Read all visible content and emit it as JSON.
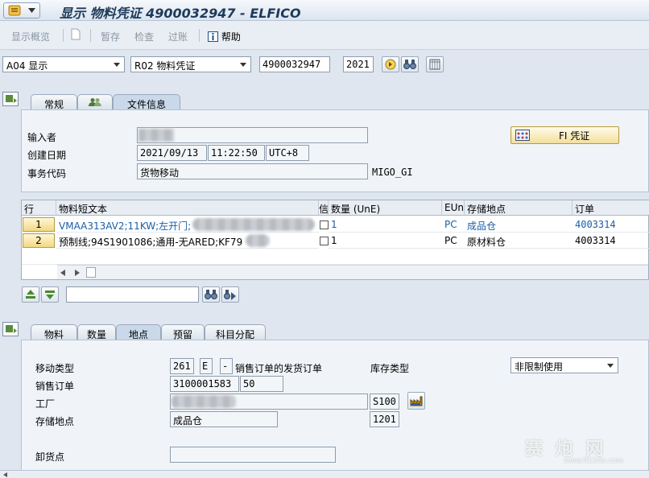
{
  "title": "显示 物料凭证 4900032947 - ELFICO",
  "toolbar": {
    "items": [
      "显示概览",
      "暂存",
      "检查",
      "过账",
      "帮助"
    ]
  },
  "selection": {
    "action": "A04 显示",
    "doc_type": "R02 物料凭证",
    "doc_number": "4900032947",
    "year": "2021"
  },
  "header_tabs": [
    "常规",
    "文件信息"
  ],
  "header": {
    "entered_by_label": "输入者",
    "created_on_label": "创建日期",
    "date": "2021/09/13",
    "time": "11:22:50",
    "timezone": "UTC+8",
    "trans_code_label": "事务代码",
    "trans_code_value": "货物移动",
    "trans_code": "MIGO_GI",
    "fi_button": "FI 凭证"
  },
  "items_table": {
    "columns": [
      "行",
      "物料短文本",
      "信",
      "数量 (UnE)",
      "EUn",
      "存储地点",
      "订单"
    ],
    "rows": [
      {
        "line": "1",
        "text": "VMAA313AV2;11KW;左开门;",
        "qty": "1",
        "unit": "PC",
        "sloc": "成品仓",
        "order": "4003314"
      },
      {
        "line": "2",
        "text": "预制线;94S1901086;通用-无ARED;KF79",
        "qty": "1",
        "unit": "PC",
        "sloc": "原材料仓",
        "order": "4003314"
      }
    ]
  },
  "detail_tabs": [
    "物料",
    "数量",
    "地点",
    "预留",
    "科目分配"
  ],
  "detail": {
    "movement_type_label": "移动类型",
    "movement_type": "261",
    "movement_flag": "E",
    "movement_dash": "-",
    "movement_desc": "销售订单的发货订单",
    "stock_type_label": "库存类型",
    "stock_type": "非限制使用",
    "sales_order_label": "销售订单",
    "sales_order": "3100001583",
    "sales_order_item": "50",
    "plant_label": "工厂",
    "plant": "S100",
    "sloc_label": "存储地点",
    "sloc": "成品仓",
    "sloc_code": "1201",
    "unloading_label": "卸货点"
  },
  "watermark": {
    "brand": "赛 炮 网",
    "url": "www.9154o.com"
  }
}
